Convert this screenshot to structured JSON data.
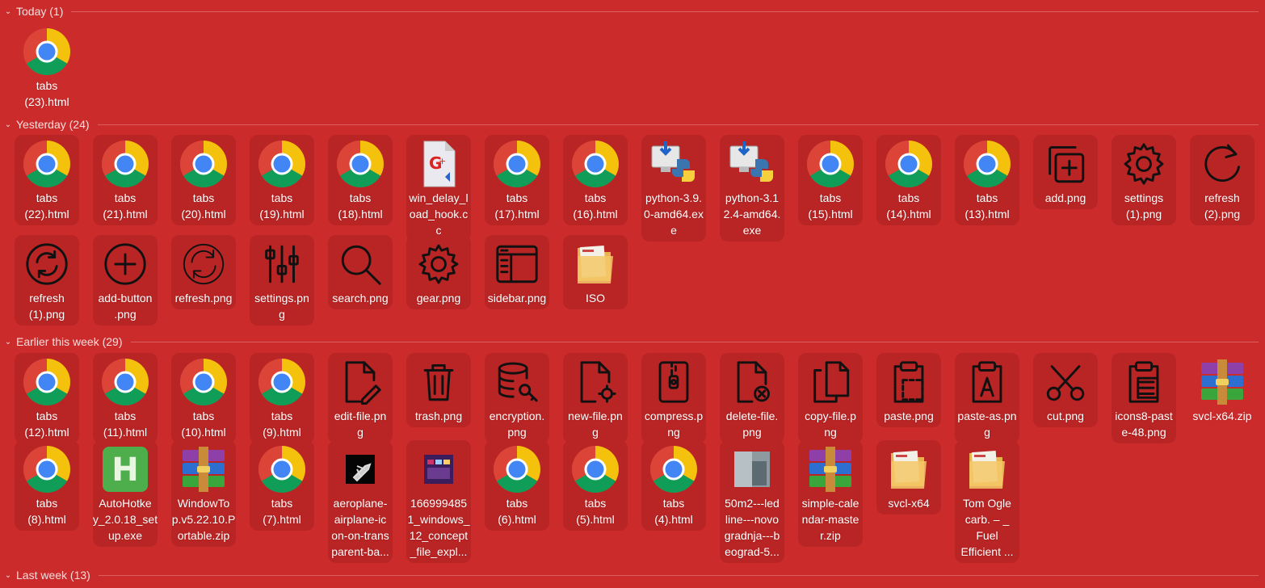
{
  "groups": [
    {
      "id": "today",
      "title": "Today (1)",
      "items": [
        {
          "name": "tabs\n(23).html",
          "icon": "chrome-icon"
        }
      ]
    },
    {
      "id": "yesterday",
      "title": "Yesterday (24)",
      "items": [
        {
          "name": "tabs\n(22).html",
          "icon": "chrome-icon"
        },
        {
          "name": "tabs\n(21).html",
          "icon": "chrome-icon"
        },
        {
          "name": "tabs\n(20).html",
          "icon": "chrome-icon"
        },
        {
          "name": "tabs\n(19).html",
          "icon": "chrome-icon"
        },
        {
          "name": "tabs\n(18).html",
          "icon": "chrome-icon"
        },
        {
          "name": "win_delay_l\noad_hook.c\nc",
          "icon": "cpp-file-icon"
        },
        {
          "name": "tabs\n(17).html",
          "icon": "chrome-icon"
        },
        {
          "name": "tabs\n(16).html",
          "icon": "chrome-icon"
        },
        {
          "name": "python-3.9.\n0-amd64.ex\ne",
          "icon": "python-installer-icon"
        },
        {
          "name": "python-3.1\n2.4-amd64.\nexe",
          "icon": "python-installer-icon"
        },
        {
          "name": "tabs\n(15).html",
          "icon": "chrome-icon"
        },
        {
          "name": "tabs\n(14).html",
          "icon": "chrome-icon"
        },
        {
          "name": "tabs\n(13).html",
          "icon": "chrome-icon"
        },
        {
          "name": "add.png",
          "icon": "add-square-icon"
        },
        {
          "name": "settings\n(1).png",
          "icon": "gear-icon"
        },
        {
          "name": "refresh\n(2).png",
          "icon": "refresh-icon"
        },
        {
          "name": "refresh\n(1).png",
          "icon": "refresh-circle-icon"
        },
        {
          "name": "add-button\n.png",
          "icon": "add-circle-icon"
        },
        {
          "name": "refresh.png",
          "icon": "refresh-thin-icon"
        },
        {
          "name": "settings.pn\ng",
          "icon": "sliders-icon"
        },
        {
          "name": "search.png",
          "icon": "search-icon"
        },
        {
          "name": "gear.png",
          "icon": "gear-thin-icon"
        },
        {
          "name": "sidebar.png",
          "icon": "sidebar-icon"
        },
        {
          "name": "ISO",
          "icon": "folder-icon"
        }
      ]
    },
    {
      "id": "earlier",
      "title": "Earlier this week (29)",
      "items": [
        {
          "name": "tabs\n(12).html",
          "icon": "chrome-icon"
        },
        {
          "name": "tabs\n(11).html",
          "icon": "chrome-icon"
        },
        {
          "name": "tabs\n(10).html",
          "icon": "chrome-icon"
        },
        {
          "name": "tabs\n(9).html",
          "icon": "chrome-icon"
        },
        {
          "name": "edit-file.pn\ng",
          "icon": "edit-file-icon"
        },
        {
          "name": "trash.png",
          "icon": "trash-icon"
        },
        {
          "name": "encryption.\npng",
          "icon": "encryption-icon"
        },
        {
          "name": "new-file.pn\ng",
          "icon": "new-file-icon"
        },
        {
          "name": "compress.p\nng",
          "icon": "compress-icon"
        },
        {
          "name": "delete-file.\npng",
          "icon": "delete-file-icon"
        },
        {
          "name": "copy-file.p\nng",
          "icon": "copy-file-icon"
        },
        {
          "name": "paste.png",
          "icon": "paste-icon"
        },
        {
          "name": "paste-as.pn\ng",
          "icon": "paste-as-icon"
        },
        {
          "name": "cut.png",
          "icon": "scissors-icon"
        },
        {
          "name": "icons8-past\ne-48.png",
          "icon": "paste-list-icon"
        },
        {
          "name": "svcl-x64.zip",
          "icon": "winrar-archive-icon"
        },
        {
          "name": "tabs\n(8).html",
          "icon": "chrome-icon"
        },
        {
          "name": "AutoHotke\ny_2.0.18_set\nup.exe",
          "icon": "autohotkey-icon"
        },
        {
          "name": "WindowTo\np.v5.22.10.P\nortable.zip",
          "icon": "winrar-archive-icon"
        },
        {
          "name": "tabs\n(7).html",
          "icon": "chrome-icon"
        },
        {
          "name": "aeroplane-\nairplane-ic\non-on-trans\nparent-ba...",
          "icon": "airplane-thumbnail-icon"
        },
        {
          "name": "166999485\n1_windows_\n12_concept\n_file_expl...",
          "icon": "screenshot-thumbnail-icon"
        },
        {
          "name": "tabs\n(6).html",
          "icon": "chrome-icon"
        },
        {
          "name": "tabs\n(5).html",
          "icon": "chrome-icon"
        },
        {
          "name": "tabs\n(4).html",
          "icon": "chrome-icon"
        },
        {
          "name": "50m2---led\nline---novo\ngradnja---b\neograd-5...",
          "icon": "photo-thumbnail-icon"
        },
        {
          "name": "simple-cale\nndar-maste\nr.zip",
          "icon": "winrar-archive-icon"
        },
        {
          "name": "svcl-x64",
          "icon": "folder-icon"
        },
        {
          "name": "Tom Ogle\ncarb. – _\nFuel\nEfficient ...",
          "icon": "folder-icon"
        }
      ]
    },
    {
      "id": "lastweek",
      "title": "Last week (13)",
      "items": []
    }
  ],
  "colors": {
    "background": "#cc2b2b",
    "tile": "#b92424",
    "text": "#ffffff"
  }
}
